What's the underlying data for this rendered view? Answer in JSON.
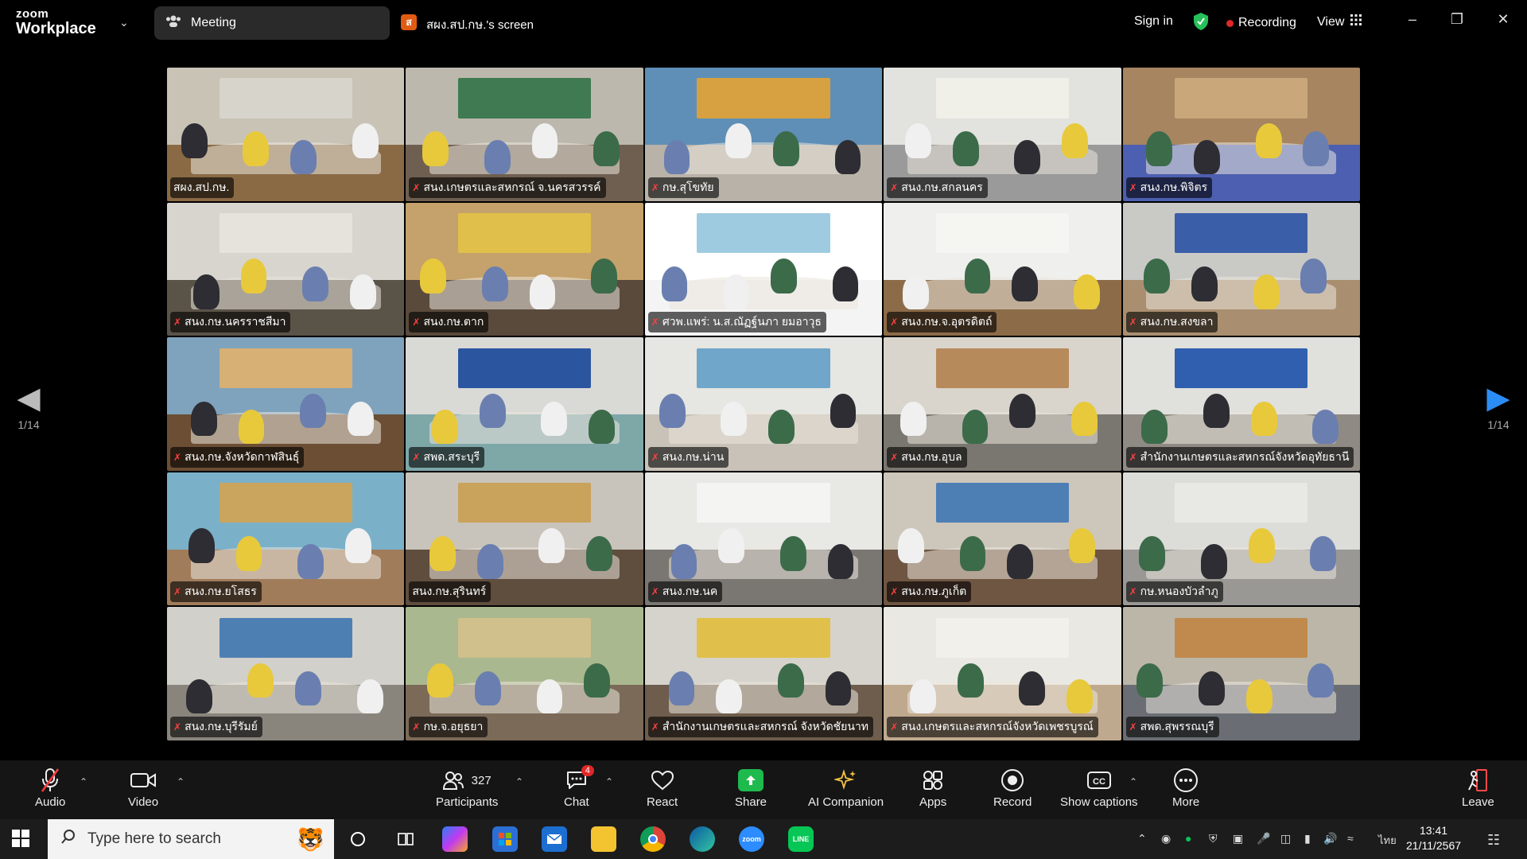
{
  "app": {
    "brand_top": "zoom",
    "brand_bottom": "Workplace"
  },
  "header": {
    "meeting_tab": "Meeting",
    "screen_badge": "ส",
    "screen_title": "สผง.สป.กษ.'s screen",
    "sign_in": "Sign in",
    "recording": "Recording",
    "view": "View"
  },
  "paging": {
    "left_page": "1/14",
    "right_page": "1/14"
  },
  "participants": [
    {
      "name": "สผง.สป.กษ.",
      "muted": false,
      "active": true,
      "wall": "#c9c3b6",
      "floor": "#8a6a45",
      "banner": "#d7d4cc"
    },
    {
      "name": "สนง.เกษตรและสหกรณ์ จ.นครสวรรค์",
      "muted": true,
      "active": false,
      "wall": "#bdb8ad",
      "floor": "#6f5f50",
      "banner": "#3f7a52"
    },
    {
      "name": "กษ.สุโขทัย",
      "muted": true,
      "active": false,
      "wall": "#5f8fb6",
      "floor": "#b9b2a8",
      "banner": "#d7a040"
    },
    {
      "name": "สนง.กษ.สกลนคร",
      "muted": true,
      "active": false,
      "wall": "#e2e2de",
      "floor": "#9a9a9a",
      "banner": "#f0efe8"
    },
    {
      "name": "สนง.กษ.พิจิตร",
      "muted": true,
      "active": false,
      "wall": "#a68560",
      "floor": "#4c5fb0",
      "banner": "#caa77a"
    },
    {
      "name": "สนง.กษ.นครราชสีมา",
      "muted": true,
      "active": false,
      "wall": "#d8d5cf",
      "floor": "#5a5348",
      "banner": "#e6e3dc"
    },
    {
      "name": "สนง.กษ.ตาก",
      "muted": true,
      "active": false,
      "wall": "#c5a26b",
      "floor": "#5a4a3c",
      "banner": "#e0c04a"
    },
    {
      "name": "ศวพ.แพร่: น.ส.ณัฏฐ์นภา ยมอาวุธ",
      "muted": true,
      "active": false,
      "wall": "#ffffff",
      "floor": "#f4f4f4",
      "banner": "#9fcbe0"
    },
    {
      "name": "สนง.กษ.จ.อุตรดิตถ์",
      "muted": true,
      "active": false,
      "wall": "#efefed",
      "floor": "#8c6b48",
      "banner": "#f5f5f2"
    },
    {
      "name": "สนง.กษ.สงขลา",
      "muted": true,
      "active": false,
      "wall": "#c9c9c6",
      "floor": "#a98f70",
      "banner": "#3a5ea8"
    },
    {
      "name": "สนง.กษ.จังหวัดกาฬสินธุ์",
      "muted": true,
      "active": false,
      "wall": "#7fa3bd",
      "floor": "#6b4e34",
      "banner": "#d6b074"
    },
    {
      "name": "สพด.สระบุรี",
      "muted": true,
      "active": false,
      "wall": "#d9d9d6",
      "floor": "#7ea7a8",
      "banner": "#2c55a0"
    },
    {
      "name": "สนง.กษ.น่าน",
      "muted": true,
      "active": false,
      "wall": "#e6e6e3",
      "floor": "#c8c2b8",
      "banner": "#6fa6c9"
    },
    {
      "name": "สนง.กษ.อุบล",
      "muted": true,
      "active": false,
      "wall": "#d9d5cc",
      "floor": "#7a7670",
      "banner": "#b78a5c"
    },
    {
      "name": "สำนักงานเกษตรและสหกรณ์จังหวัดอุทัยธานี",
      "muted": true,
      "active": false,
      "wall": "#e0e0dc",
      "floor": "#8f8a83",
      "banner": "#2f5fae"
    },
    {
      "name": "สนง.กษ.ยโสธร",
      "muted": true,
      "active": false,
      "wall": "#7bb0c9",
      "floor": "#a07c5b",
      "banner": "#c9a55e"
    },
    {
      "name": "สนง.กษ.สุรินทร์",
      "muted": false,
      "active": false,
      "wall": "#c8c4bb",
      "floor": "#5f4d3e",
      "banner": "#c9a25b"
    },
    {
      "name": "สนง.กษ.นค",
      "muted": true,
      "active": false,
      "wall": "#e8e8e5",
      "floor": "#7a7772",
      "banner": "#f4f4f2"
    },
    {
      "name": "สนง.กษ.ภูเก็ต",
      "muted": true,
      "active": false,
      "wall": "#cdc6ba",
      "floor": "#6f5642",
      "banner": "#4d7fb5"
    },
    {
      "name": "กษ.หนองบัวลำภู",
      "muted": true,
      "active": false,
      "wall": "#dcdcd8",
      "floor": "#9a9894",
      "banner": "#e8e8e4"
    },
    {
      "name": "สนง.กษ.บุรีรัมย์",
      "muted": true,
      "active": false,
      "wall": "#d2d0ca",
      "floor": "#8a857c",
      "banner": "#4e7fb3"
    },
    {
      "name": "กษ.จ.อยุธยา",
      "muted": true,
      "active": false,
      "wall": "#aab88f",
      "floor": "#7b6a58",
      "banner": "#d0c08c"
    },
    {
      "name": "สำนักงานเกษตรและสหกรณ์ จังหวัดชัยนาท",
      "muted": true,
      "active": false,
      "wall": "#d6d3cc",
      "floor": "#6e5d4c",
      "banner": "#e0c04a"
    },
    {
      "name": "สนง.เกษตรและสหกรณ์จังหวัดเพชรบูรณ์",
      "muted": true,
      "active": false,
      "wall": "#eae8e2",
      "floor": "#bfa98e",
      "banner": "#f2f0ea"
    },
    {
      "name": "สพด.สุพรรณบุรี",
      "muted": true,
      "active": false,
      "wall": "#bcb6a8",
      "floor": "#6a6e74",
      "banner": "#c08a4e"
    }
  ],
  "toolbar": {
    "audio": "Audio",
    "video": "Video",
    "participants": "Participants",
    "participants_count": "327",
    "chat": "Chat",
    "chat_badge": "4",
    "react": "React",
    "share": "Share",
    "ai_companion": "AI Companion",
    "apps": "Apps",
    "record": "Record",
    "captions": "Show captions",
    "more": "More",
    "leave": "Leave"
  },
  "taskbar": {
    "search_placeholder": "Type here to search",
    "lang": "ไทย",
    "time": "13:41",
    "date": "21/11/2567"
  },
  "colors": {
    "active_border": "#3ad46e",
    "recording_dot": "#e02828",
    "share_green": "#1fba4d"
  }
}
